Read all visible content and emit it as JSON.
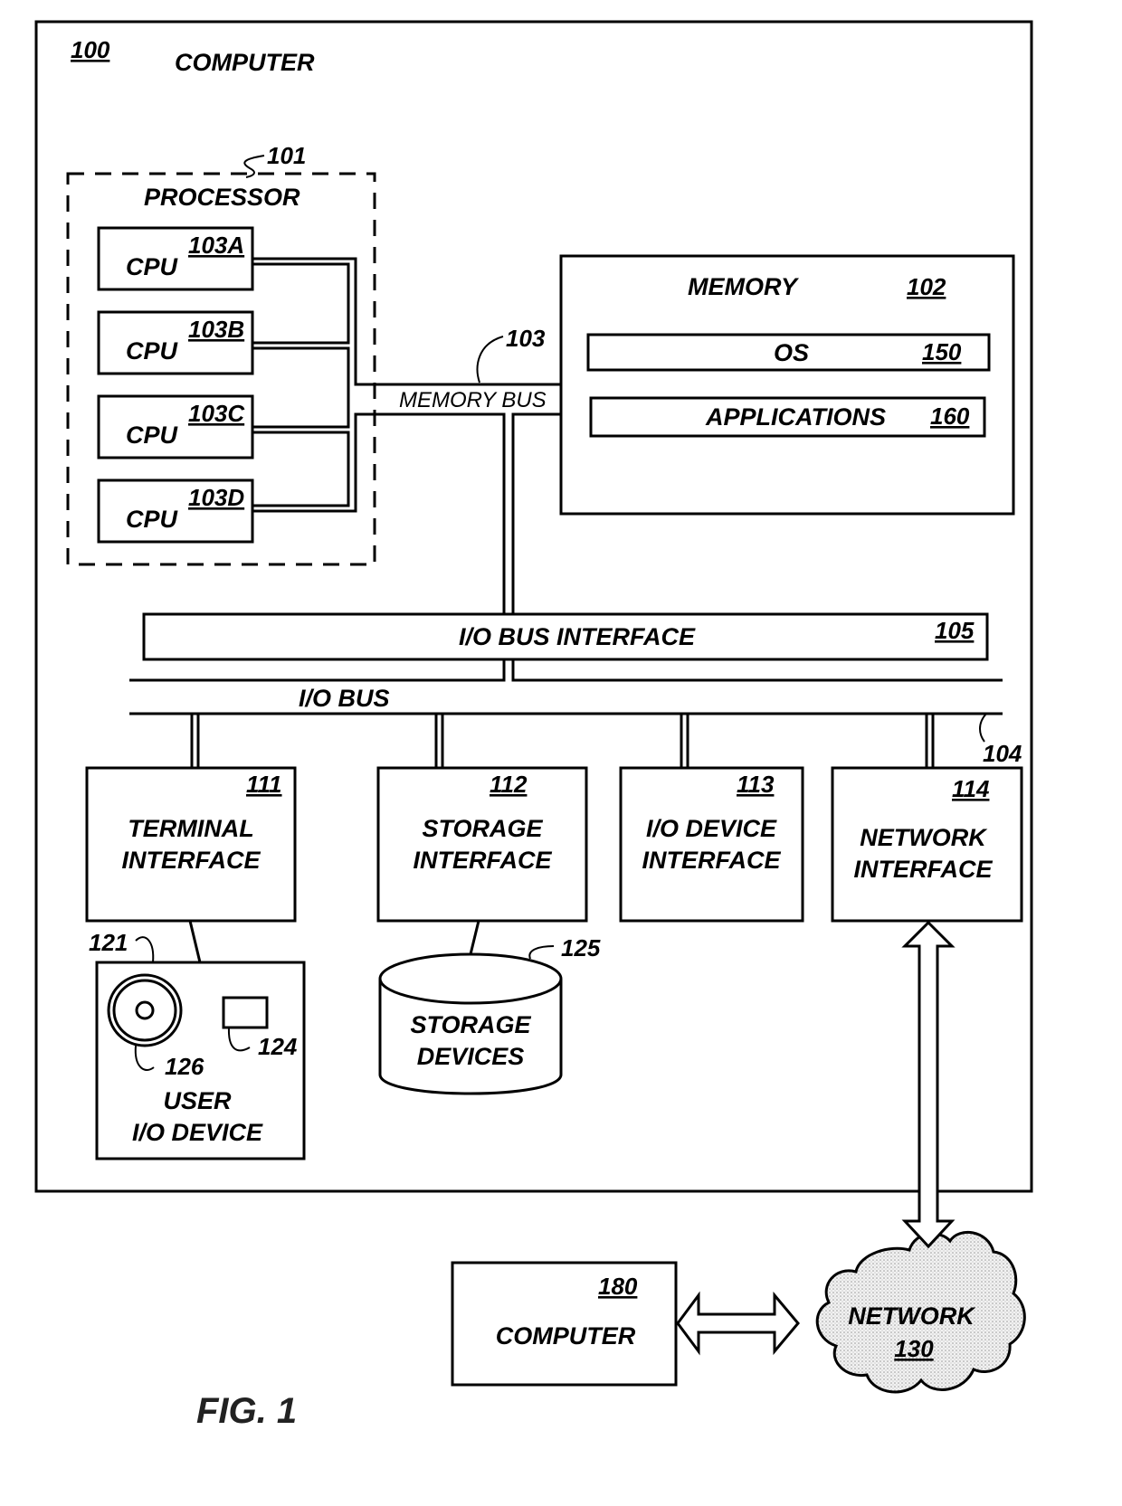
{
  "figure": {
    "caption": "FIG. 1",
    "computer": {
      "ref": "100",
      "label": "COMPUTER"
    },
    "processor": {
      "ref": "101",
      "label": "PROCESSOR",
      "cpus": [
        {
          "label": "CPU",
          "ref": "103A"
        },
        {
          "label": "CPU",
          "ref": "103B"
        },
        {
          "label": "CPU",
          "ref": "103C"
        },
        {
          "label": "CPU",
          "ref": "103D"
        }
      ]
    },
    "memory_bus": {
      "label": "MEMORY BUS",
      "ref": "103"
    },
    "memory": {
      "label": "MEMORY",
      "ref": "102",
      "os": {
        "label": "OS",
        "ref": "150"
      },
      "applications": {
        "label": "APPLICATIONS",
        "ref": "160"
      }
    },
    "io_bus_interface": {
      "label": "I/O BUS INTERFACE",
      "ref": "105"
    },
    "io_bus": {
      "label": "I/O BUS",
      "ref": "104"
    },
    "interfaces": [
      {
        "line1": "TERMINAL",
        "line2": "INTERFACE",
        "ref": "111"
      },
      {
        "line1": "STORAGE",
        "line2": "INTERFACE",
        "ref": "112"
      },
      {
        "line1": "I/O DEVICE",
        "line2": "INTERFACE",
        "ref": "113"
      },
      {
        "line1": "NETWORK",
        "line2": "INTERFACE",
        "ref": "114"
      }
    ],
    "user_io_device": {
      "line1": "USER",
      "line2": "I/O DEVICE",
      "ref": "121",
      "display_ref": "126",
      "input_ref": "124"
    },
    "storage_devices": {
      "line1": "STORAGE",
      "line2": "DEVICES",
      "ref": "125"
    },
    "network": {
      "label": "NETWORK",
      "ref": "130"
    },
    "remote_computer": {
      "label": "COMPUTER",
      "ref": "180"
    }
  }
}
